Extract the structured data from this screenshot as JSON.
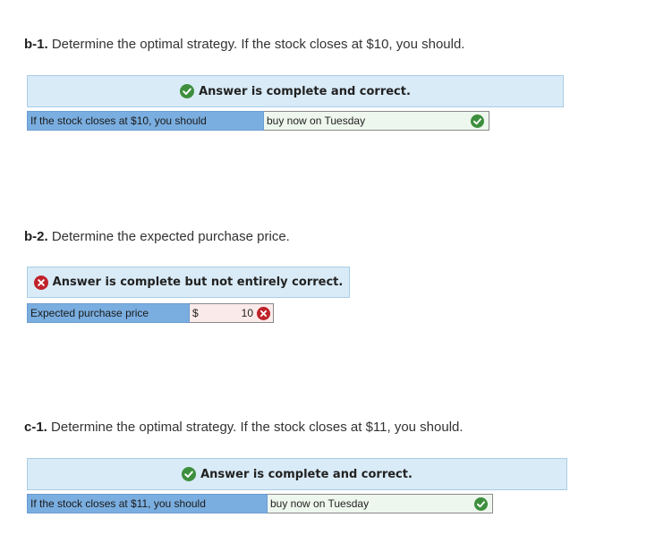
{
  "b1": {
    "num": "b-1.",
    "question": "Determine the optimal strategy. If the stock closes at $10, you should.",
    "status": "Answer is complete and correct.",
    "field_label": "If the stock closes at $10, you should",
    "field_value": "buy now on Tuesday"
  },
  "b2": {
    "num": "b-2.",
    "question": "Determine the expected purchase price.",
    "status": "Answer is complete but not entirely correct.",
    "field_label": "Expected purchase price",
    "currency": "$",
    "field_value": "10"
  },
  "c1": {
    "num": "c-1.",
    "question": "Determine the optimal strategy. If the stock closes at $11, you should.",
    "status": "Answer is complete and correct.",
    "field_label": "If the stock closes at $11, you should",
    "field_value": "buy now on Tuesday"
  },
  "colors": {
    "banner_bg": "#d9ebf7",
    "label_bg": "#7aaee0",
    "correct": "#3d8f3d",
    "incorrect": "#c0232b"
  },
  "icons": [
    "check-circle-icon",
    "x-circle-icon"
  ]
}
